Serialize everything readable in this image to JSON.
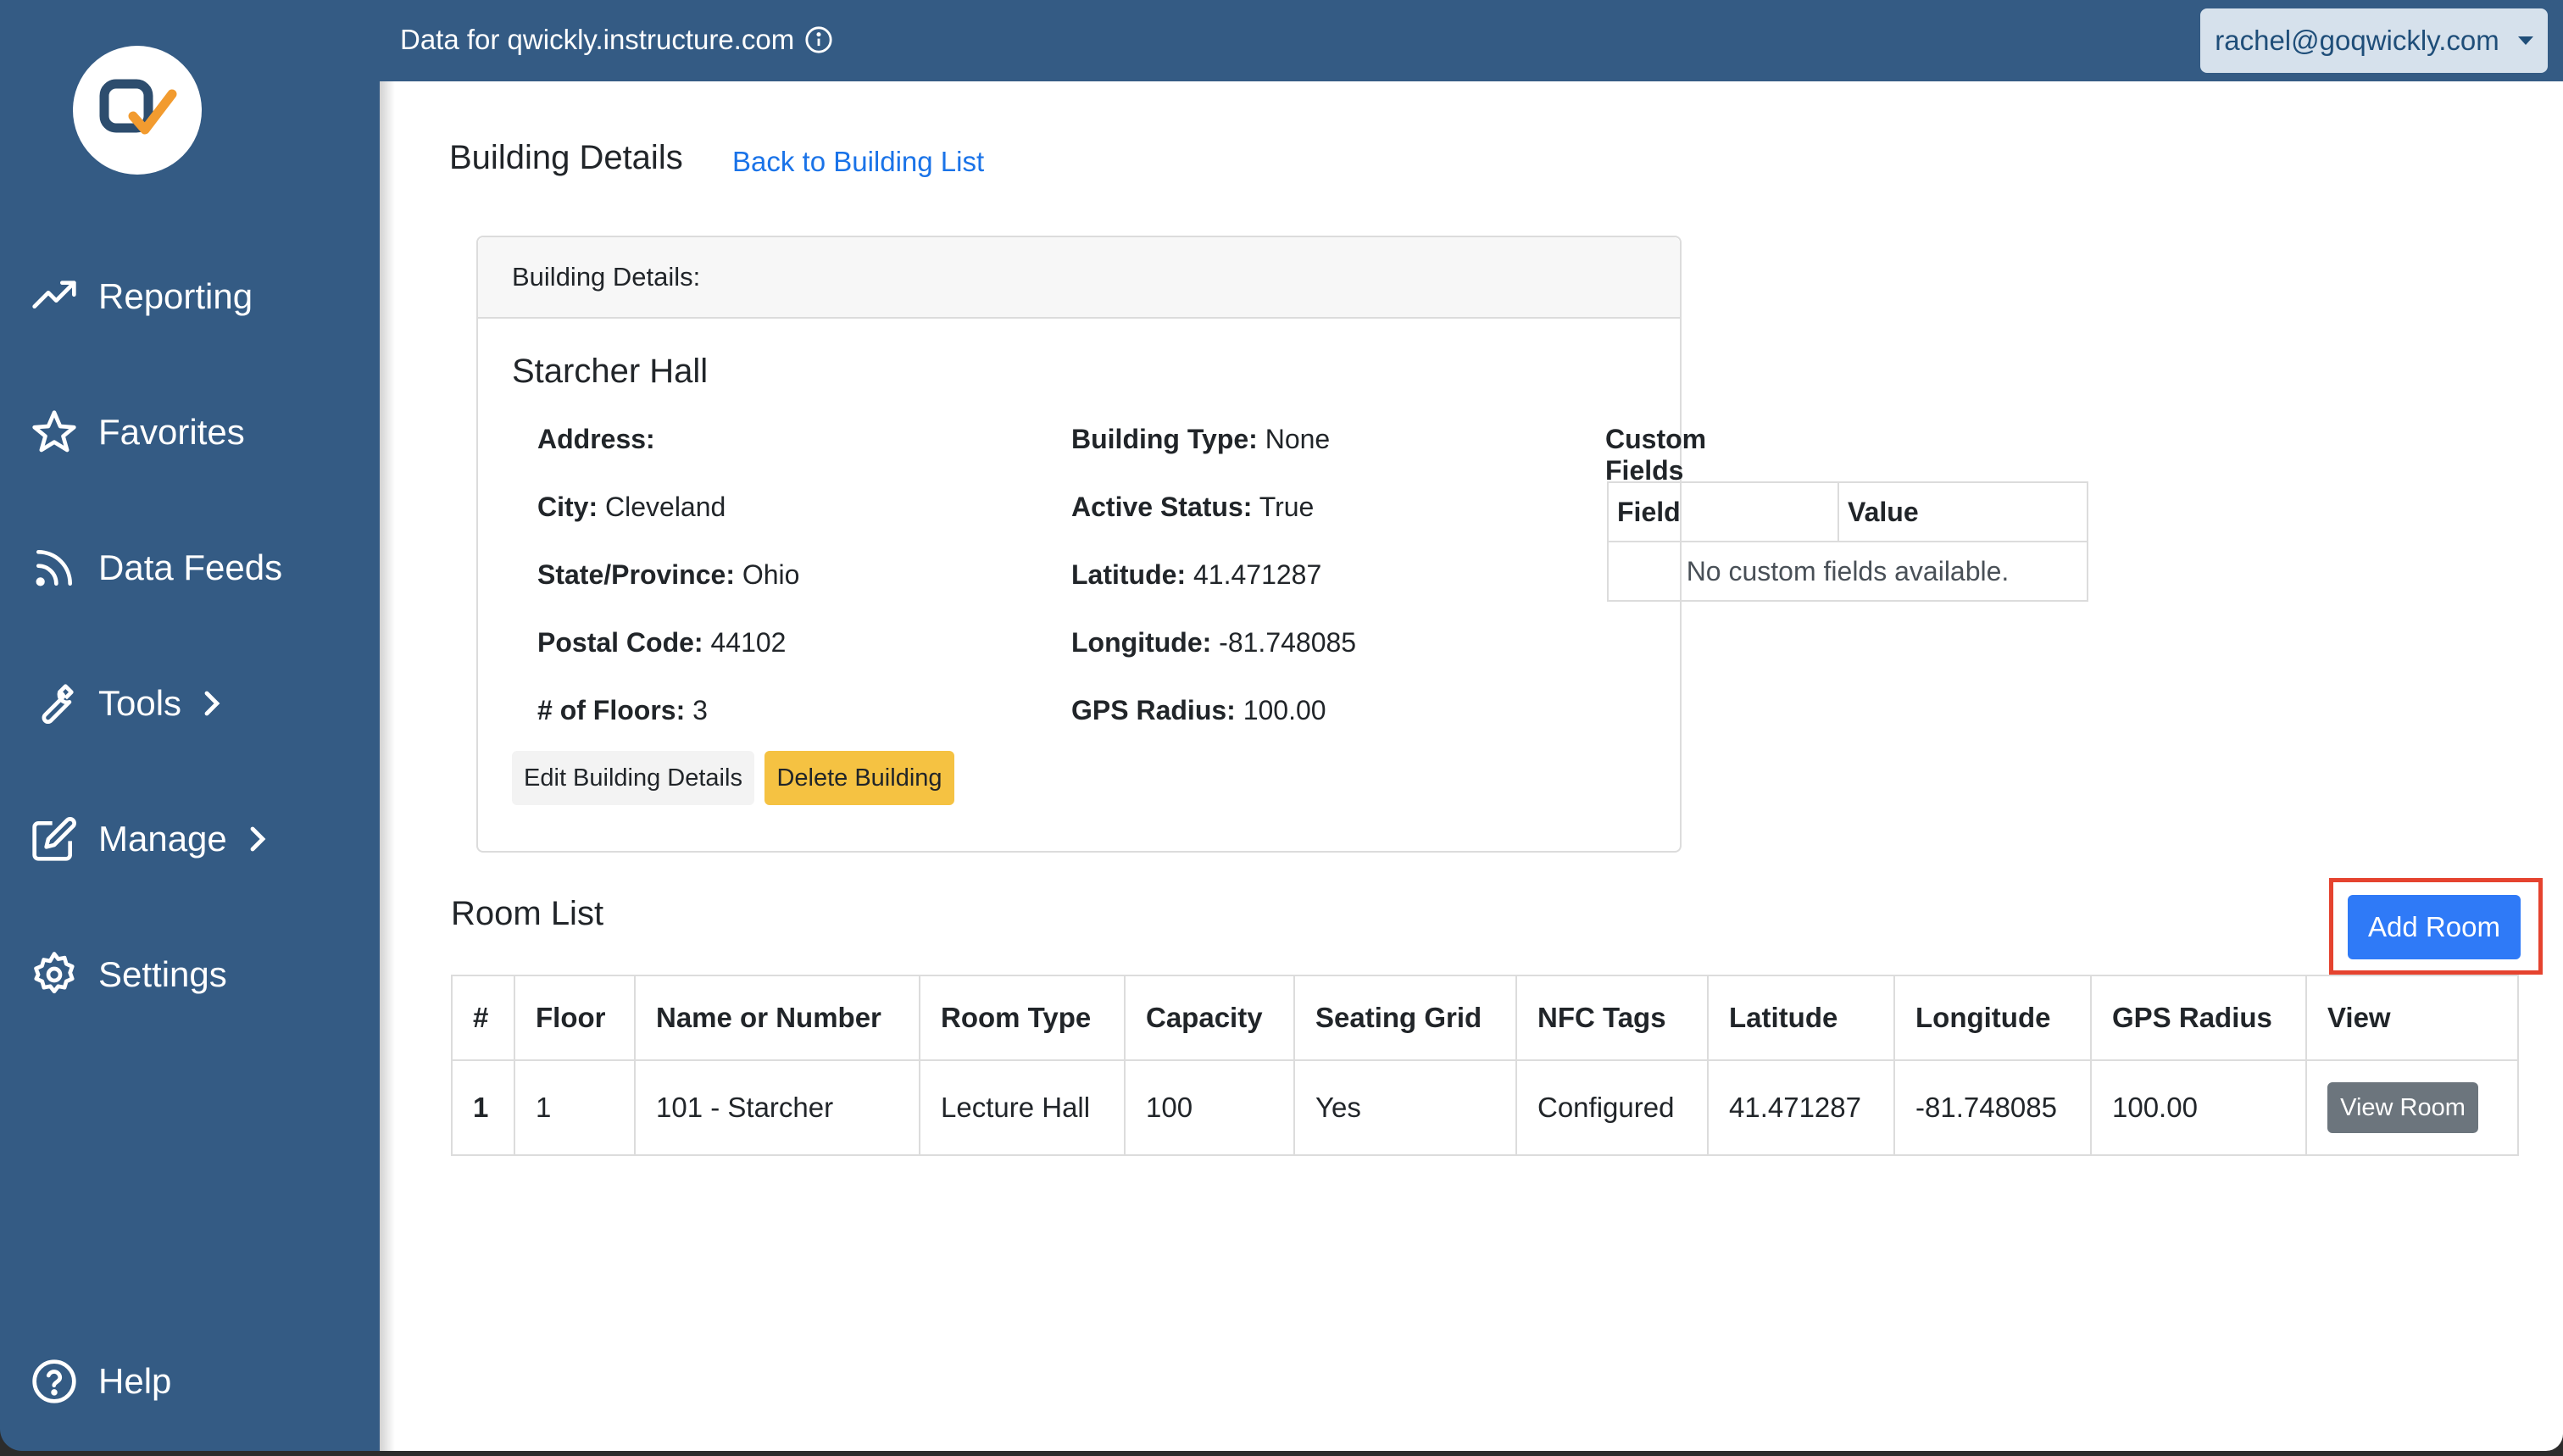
{
  "topbar": {
    "title": "Data for qwickly.instructure.com",
    "user_email": "rachel@goqwickly.com"
  },
  "sidebar": {
    "items": [
      {
        "label": "Reporting",
        "icon": "trend-up-icon"
      },
      {
        "label": "Favorites",
        "icon": "star-icon"
      },
      {
        "label": "Data Feeds",
        "icon": "rss-icon"
      },
      {
        "label": "Tools",
        "icon": "wrench-icon"
      },
      {
        "label": "Manage",
        "icon": "edit-icon"
      },
      {
        "label": "Settings",
        "icon": "gear-icon"
      },
      {
        "label": "Help",
        "icon": "help-circle-icon"
      }
    ]
  },
  "page": {
    "title": "Building Details",
    "back_link": "Back to Building List"
  },
  "card": {
    "header": "Building Details:",
    "building_name": "Starcher Hall",
    "address_label": "Address:",
    "address_value": "",
    "city_label": "City:",
    "city_value": "Cleveland",
    "state_label": "State/Province:",
    "state_value": "Ohio",
    "postal_label": "Postal Code:",
    "postal_value": "44102",
    "floors_label": "# of Floors:",
    "floors_value": "3",
    "type_label": "Building Type:",
    "type_value": "None",
    "active_label": "Active Status:",
    "active_value": "True",
    "lat_label": "Latitude:",
    "lat_value": "41.471287",
    "lon_label": "Longitude:",
    "lon_value": "-81.748085",
    "radius_label": "GPS Radius:",
    "radius_value": "100.00",
    "custom_fields_title": "Custom Fields",
    "cf_header_field": "Field",
    "cf_header_value": "Value",
    "cf_empty": "No custom fields available.",
    "edit_button": "Edit Building Details",
    "delete_button": "Delete Building"
  },
  "rooms": {
    "title": "Room List",
    "add_button": "Add Room",
    "columns": [
      "#",
      "Floor",
      "Name or Number",
      "Room Type",
      "Capacity",
      "Seating Grid",
      "NFC Tags",
      "Latitude",
      "Longitude",
      "GPS Radius",
      "View"
    ],
    "rows": [
      {
        "num": "1",
        "floor": "1",
        "name": "101 - Starcher",
        "type": "Lecture Hall",
        "capacity": "100",
        "seating": "Yes",
        "nfc": "Configured",
        "lat": "41.471287",
        "lon": "-81.748085",
        "radius": "100.00",
        "view_button": "View Room"
      }
    ]
  },
  "colors": {
    "sidebar_bg": "#345b84",
    "primary": "#2f7af7",
    "warning": "#f5c242",
    "highlight": "#e5432f",
    "link": "#1a73e8"
  }
}
